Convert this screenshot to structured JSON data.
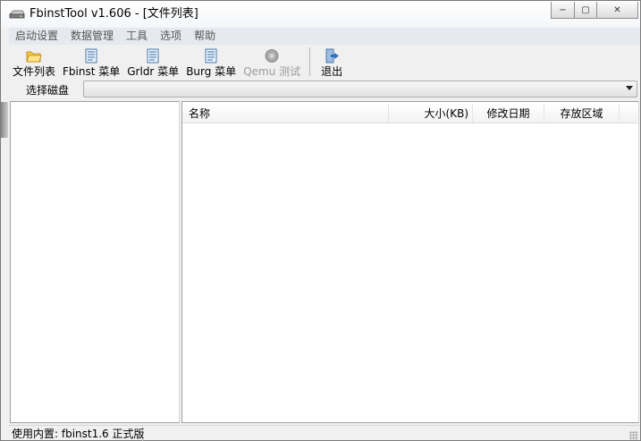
{
  "window": {
    "title": "FbinstTool v1.606 - [文件列表]",
    "controls": {
      "minimize": "−",
      "maximize": "▢",
      "close": "✕"
    }
  },
  "menu": [
    {
      "label": "启动设置"
    },
    {
      "label": "数据管理"
    },
    {
      "label": "工具"
    },
    {
      "label": "选项"
    },
    {
      "label": "帮助"
    }
  ],
  "toolbar": [
    {
      "label": "文件列表",
      "icon": "folder-icon",
      "enabled": true
    },
    {
      "label": "Fbinst 菜单",
      "icon": "menu-doc-icon",
      "enabled": true
    },
    {
      "label": "Grldr 菜单",
      "icon": "menu-doc-icon",
      "enabled": true
    },
    {
      "label": "Burg 菜单",
      "icon": "menu-doc-icon",
      "enabled": true
    },
    {
      "label": "Qemu 测试",
      "icon": "qemu-icon",
      "enabled": false
    },
    {
      "label": "退出",
      "icon": "exit-icon",
      "enabled": true
    }
  ],
  "disk": {
    "label": "选择磁盘",
    "selected": ""
  },
  "file_list": {
    "columns": [
      "名称",
      "大小(KB)",
      "修改日期",
      "存放区域"
    ],
    "rows": []
  },
  "status": {
    "text": "使用内置: fbinst1.6 正式版"
  },
  "colors": {
    "menubar_bg": "#e6e9ef",
    "window_bg": "#f0f0f0",
    "pane_bg": "#ffffff",
    "disabled_text": "#9a9a9a"
  }
}
